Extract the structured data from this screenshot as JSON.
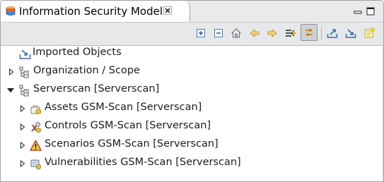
{
  "view": {
    "title": "Information Security Model",
    "icon": "database-model-icon"
  },
  "window_controls": [
    "minimize-icon",
    "maximize-icon"
  ],
  "toolbar": {
    "buttons": [
      {
        "name": "expand-all-icon"
      },
      {
        "name": "collapse-all-icon"
      },
      {
        "name": "home-icon"
      },
      {
        "name": "back-arrow-icon"
      },
      {
        "name": "forward-arrow-icon"
      },
      {
        "name": "filter-icon"
      },
      {
        "name": "link-with-editor-icon",
        "pressed": true
      },
      {
        "name": "export-icon"
      },
      {
        "name": "import-icon"
      },
      {
        "name": "new-note-icon"
      }
    ]
  },
  "tree": {
    "items": [
      {
        "label": "Imported Objects",
        "icon": "imported-objects-icon",
        "twisty": "none"
      },
      {
        "label": "Organization / Scope",
        "icon": "organization-tree-icon",
        "twisty": "collapsed"
      },
      {
        "label": "Serverscan [Serverscan]",
        "icon": "organization-tree-icon",
        "twisty": "expanded"
      },
      {
        "label": "Assets GSM-Scan [Serverscan]",
        "icon": "assets-group-icon",
        "twisty": "collapsed"
      },
      {
        "label": "Controls GSM-Scan [Serverscan]",
        "icon": "controls-group-icon",
        "twisty": "collapsed"
      },
      {
        "label": "Scenarios GSM-Scan [Serverscan]",
        "icon": "scenarios-warning-icon",
        "twisty": "collapsed"
      },
      {
        "label": "Vulnerabilities GSM-Scan [Serverscan]",
        "icon": "vulnerabilities-group-icon",
        "twisty": "collapsed"
      }
    ]
  },
  "colors": {
    "titlebar_bg": "#e9eaeb",
    "toolbar_bg": "#e7e8ea",
    "border": "#9fa3a8"
  }
}
